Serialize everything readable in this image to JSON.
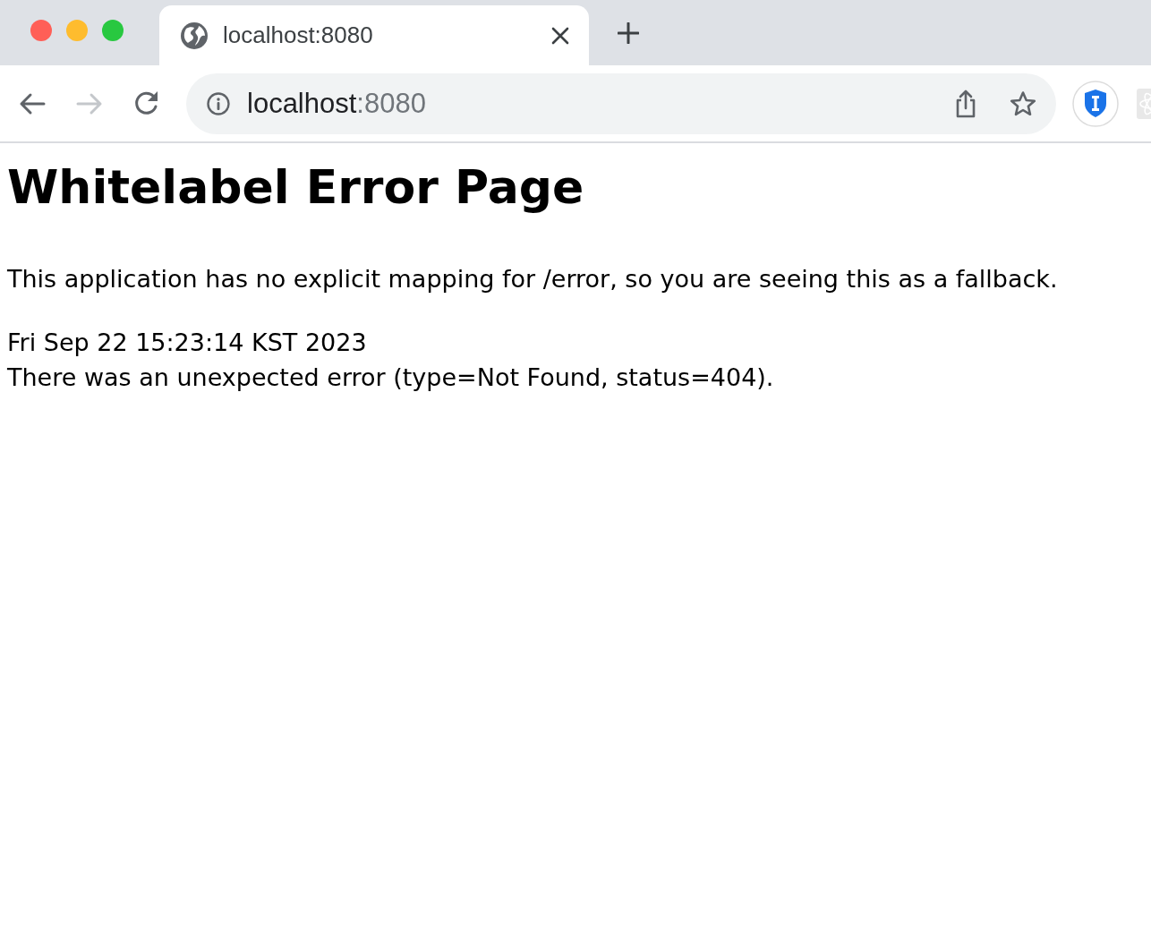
{
  "window": {
    "controls": [
      {
        "color": "#ff5f57"
      },
      {
        "color": "#febc2e"
      },
      {
        "color": "#28c840"
      }
    ]
  },
  "tabs": [
    {
      "title": "localhost:8080",
      "selected": true
    }
  ],
  "toolbar": {
    "nav_buttons": [
      {
        "kind": "back",
        "disabled": false
      },
      {
        "kind": "forward",
        "disabled": true
      },
      {
        "kind": "reload",
        "disabled": false
      }
    ],
    "address_bar": {
      "host": "localhost",
      "port": ":8080"
    },
    "actions": [
      {
        "kind": "share"
      },
      {
        "kind": "bookmark"
      }
    ],
    "extensions": [
      {
        "kind": "shield"
      },
      {
        "kind": "atom"
      }
    ]
  },
  "page": {
    "title": "Whitelabel Error Page",
    "message": "This application has no explicit mapping for /error, so you are seeing this as a fallback.",
    "timestamp": "Fri Sep 22 15:23:14 KST 2023",
    "error": "There was an unexpected error (type=Not Found, status=404)."
  }
}
